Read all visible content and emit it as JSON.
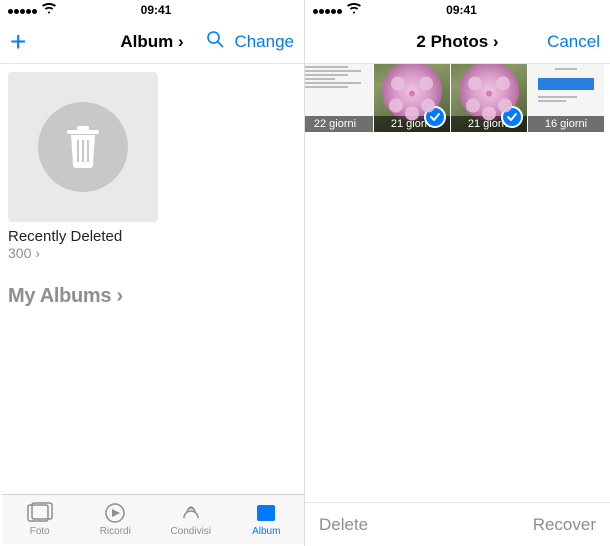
{
  "left": {
    "status": {
      "time": "09:41"
    },
    "nav": {
      "title": "Album ›",
      "edit": "Change"
    },
    "album": {
      "name": "Recently Deleted",
      "count": "300 ›"
    },
    "section": "My Albums ›",
    "tabs": {
      "photos": "Foto",
      "memories": "Ricordi",
      "shared": "Condivisi",
      "albums": "Album"
    }
  },
  "right": {
    "status": {
      "time": "09:41"
    },
    "nav": {
      "title": "2 Photos ›",
      "cancel": "Cancel"
    },
    "cells": [
      {
        "days": "22 giorni",
        "selected": false,
        "kind": "doc"
      },
      {
        "days": "21 giorni",
        "selected": true,
        "kind": "flower"
      },
      {
        "days": "21 giorni",
        "selected": true,
        "kind": "flower"
      },
      {
        "days": "16 giorni",
        "selected": false,
        "kind": "card"
      }
    ],
    "footer": {
      "delete": "Delete",
      "recover": "Recover"
    }
  }
}
